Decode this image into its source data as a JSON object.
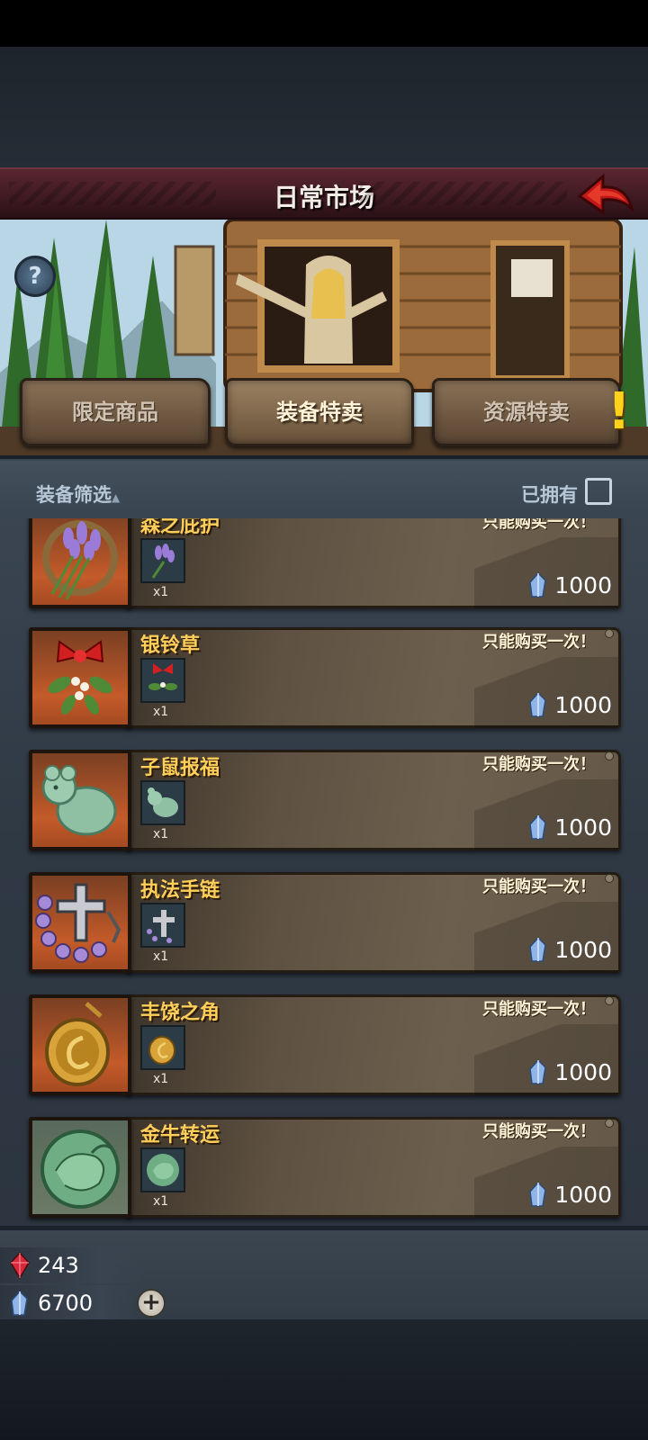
{
  "header": {
    "title": "日常市场",
    "back_icon": "red-back-arrow-icon",
    "help_label": "?"
  },
  "tabs": [
    {
      "label": "限定商品",
      "active": false
    },
    {
      "label": "装备特卖",
      "active": true
    },
    {
      "label": "资源特卖",
      "active": false,
      "alert": "!"
    }
  ],
  "filter": {
    "label": "装备筛选",
    "sort_indicator": "▲",
    "owned_label": "已拥有",
    "owned_checked": false
  },
  "items": [
    {
      "name": "森之庇护",
      "limit": "只能购买一次！",
      "qty": "x1",
      "price": "1000",
      "icon": "lavender-bundle-icon"
    },
    {
      "name": "银铃草",
      "limit": "只能购买一次！",
      "qty": "x1",
      "price": "1000",
      "icon": "mistletoe-icon"
    },
    {
      "name": "子鼠报福",
      "limit": "只能购买一次！",
      "qty": "x1",
      "price": "1000",
      "icon": "jade-rat-icon"
    },
    {
      "name": "执法手链",
      "limit": "只能购买一次！",
      "qty": "x1",
      "price": "1000",
      "icon": "cross-bracelet-icon"
    },
    {
      "name": "丰饶之角",
      "limit": "只能购买一次！",
      "qty": "x1",
      "price": "1000",
      "icon": "gold-amulet-icon"
    },
    {
      "name": "金牛转运",
      "limit": "只能购买一次！",
      "qty": "x1",
      "price": "1000",
      "icon": "jade-ox-icon"
    }
  ],
  "currency": {
    "ruby": "243",
    "gems": "6700",
    "add_label": "+"
  },
  "colors": {
    "title_bar": "#3a1820",
    "item_name": "#ffcf5a",
    "panel": "#2f3944",
    "icon_frame": "#c45b2a"
  }
}
